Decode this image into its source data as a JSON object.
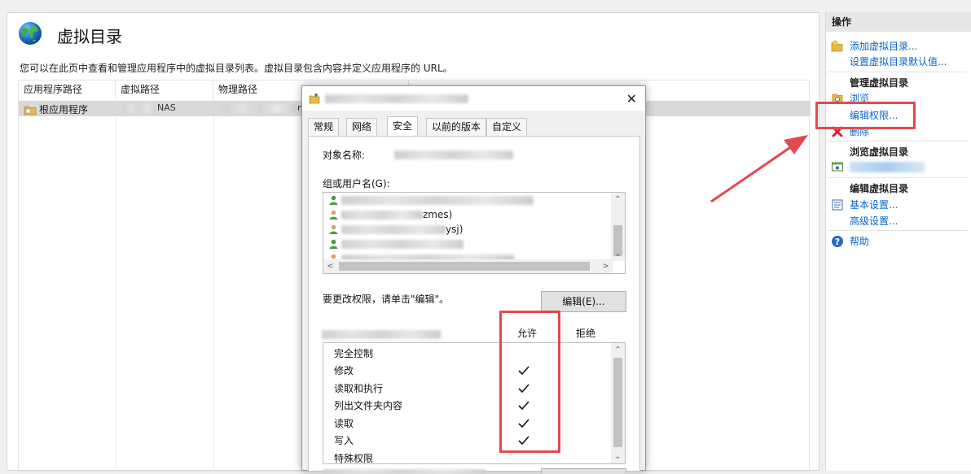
{
  "main": {
    "title": "虚拟目录",
    "description": "您可以在此页中查看和管理应用程序中的虚拟目录列表。虚拟目录包含内容并定义应用程序的 URL。",
    "columns": [
      "应用程序路径",
      "虚拟路径",
      "物理路径"
    ],
    "rows": [
      {
        "app_path": "根应用程序",
        "virtual_path_suffix": "NAS",
        "physical_path_suffix": "m"
      }
    ]
  },
  "actions": {
    "header": "操作",
    "add_virtual_dir": "添加虚拟目录...",
    "set_defaults": "设置虚拟目录默认值...",
    "section_manage": "管理虚拟目录",
    "browse": "浏览",
    "edit_permissions": "编辑权限...",
    "delete": "删除",
    "section_browse": "浏览虚拟目录",
    "section_edit": "编辑虚拟目录",
    "basic_settings": "基本设置...",
    "advanced_settings": "高级设置...",
    "help": "帮助"
  },
  "dialog": {
    "close_glyph": "✕",
    "tabs": [
      "常规",
      "网络",
      "安全",
      "以前的版本",
      "自定义"
    ],
    "active_tab": "安全",
    "object_name_label": "对象名称:",
    "group_label": "组或用户名(G):",
    "users": [
      "",
      "zmes)",
      "ysj)",
      "",
      ""
    ],
    "change_hint": "要更改权限，请单击\"编辑\"。",
    "edit_button": "编辑(E)...",
    "allow_header": "允许",
    "deny_header": "拒绝",
    "permissions": [
      {
        "name": "完全控制",
        "allow": false
      },
      {
        "name": "修改",
        "allow": true
      },
      {
        "name": "读取和执行",
        "allow": true
      },
      {
        "name": "列出文件夹内容",
        "allow": true
      },
      {
        "name": "读取",
        "allow": true
      },
      {
        "name": "写入",
        "allow": true
      },
      {
        "name": "特殊权限",
        "allow": false
      }
    ]
  },
  "colors": {
    "link": "#0a64c8",
    "annotation": "#e5484d",
    "selected_row": "#d9d9d9"
  },
  "icons": [
    "globe-icon",
    "folder-app-icon",
    "add-folder-icon",
    "browse-icon",
    "delete-icon",
    "browse-vdir-icon",
    "settings-icon",
    "help-icon",
    "user-icon",
    "check-icon"
  ]
}
